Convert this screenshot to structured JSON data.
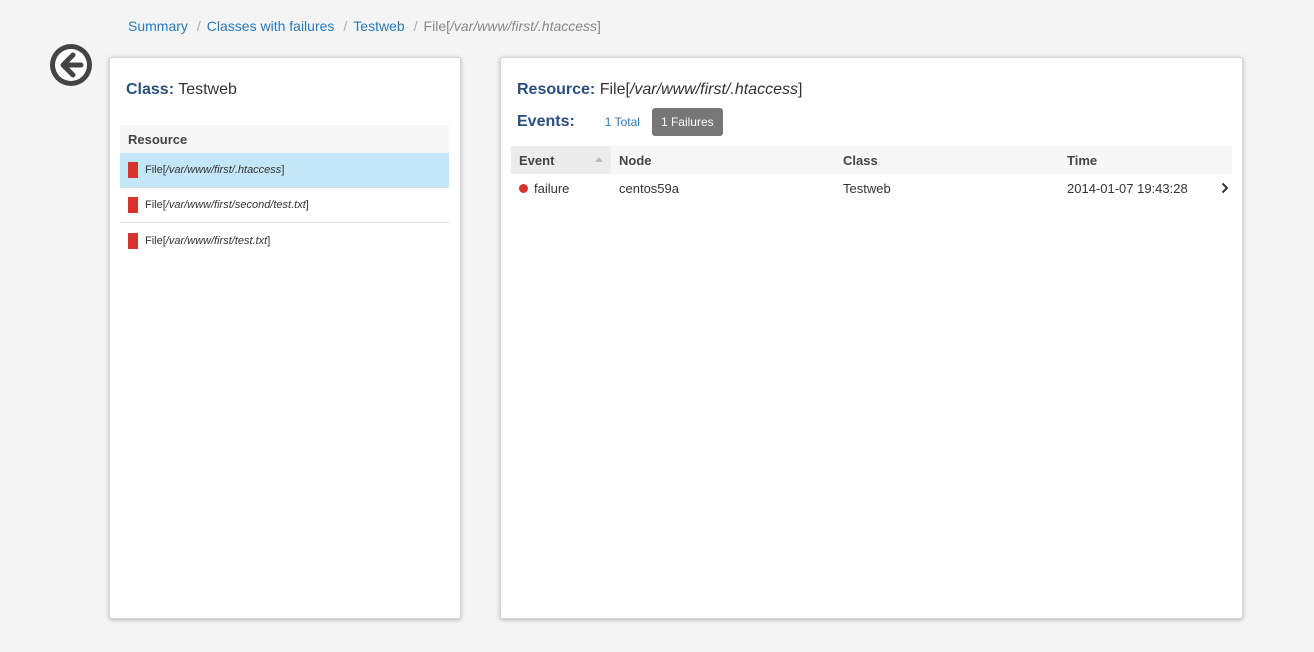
{
  "breadcrumb": {
    "items": [
      "Summary",
      "Classes with failures",
      "Testweb"
    ],
    "separator": "/",
    "current_prefix": "File[",
    "current_path": "/var/www/first/.htaccess",
    "current_suffix": "]"
  },
  "left_panel": {
    "class_label": "Class:",
    "class_value": "Testweb",
    "resource_header": "Resource",
    "resources": [
      {
        "prefix": "File[",
        "path": "/var/www/first/.htaccess",
        "suffix": "]"
      },
      {
        "prefix": "File[",
        "path": "/var/www/first/second/test.txt",
        "suffix": "]"
      },
      {
        "prefix": "File[",
        "path": "/var/www/first/test.txt",
        "suffix": "]"
      }
    ]
  },
  "right_panel": {
    "resource_label": "Resource:",
    "resource_prefix": "File[",
    "resource_path": "/var/www/first/.htaccess",
    "resource_suffix": "]",
    "events_label": "Events:",
    "total_button": "1 Total",
    "failures_button": "1 Failures",
    "columns": [
      "Event",
      "Node",
      "Class",
      "Time"
    ],
    "rows": [
      {
        "event": "failure",
        "node": "centos59a",
        "class": "Testweb",
        "time": "2014-01-07 19:43:28"
      }
    ]
  },
  "colors": {
    "accent": "#2b4f80",
    "link": "#2a7ab7",
    "failure": "#d7322d",
    "selected": "#c4e6f9"
  },
  "icons": {
    "back": "arrow-left-circle-icon",
    "row": "chevron-right-icon"
  }
}
